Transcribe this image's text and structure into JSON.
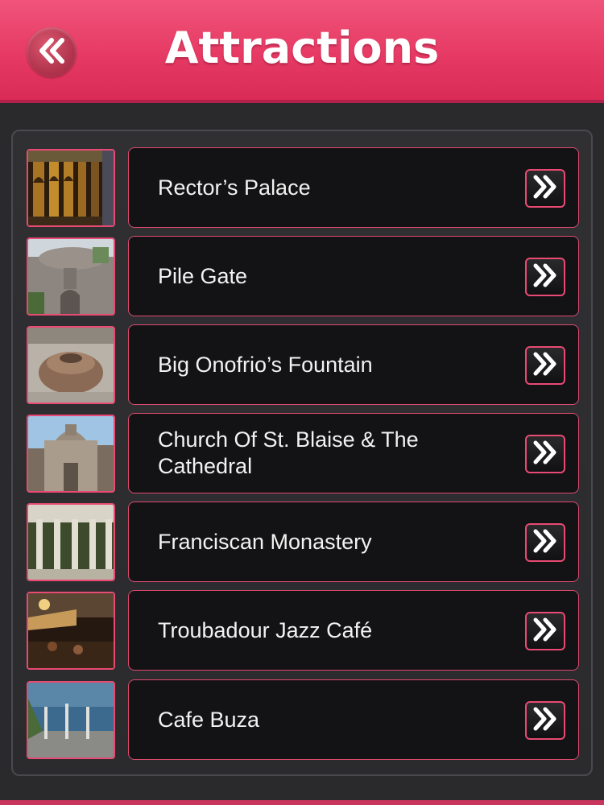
{
  "header": {
    "title": "Attractions",
    "back_icon": "double-chevron-left-icon"
  },
  "colors": {
    "header": "#e63a64",
    "accent_border": "#e84a73",
    "item_background": "#131315",
    "page_background": "#2a2a2c"
  },
  "attractions": [
    {
      "label": "Rector’s Palace",
      "thumbnail": "rectors-palace-photo",
      "action_icon": "double-chevron-right-icon"
    },
    {
      "label": "Pile Gate",
      "thumbnail": "pile-gate-photo",
      "action_icon": "double-chevron-right-icon"
    },
    {
      "label": "Big Onofrio’s Fountain",
      "thumbnail": "onofrio-fountain-photo",
      "action_icon": "double-chevron-right-icon"
    },
    {
      "label": "Church Of St. Blaise & The Cathedral",
      "thumbnail": "st-blaise-church-photo",
      "action_icon": "double-chevron-right-icon"
    },
    {
      "label": "Franciscan Monastery",
      "thumbnail": "franciscan-monastery-photo",
      "action_icon": "double-chevron-right-icon"
    },
    {
      "label": "Troubadour Jazz Café",
      "thumbnail": "troubadour-cafe-photo",
      "action_icon": "double-chevron-right-icon"
    },
    {
      "label": "Cafe Buza",
      "thumbnail": "cafe-buza-photo",
      "action_icon": "double-chevron-right-icon"
    }
  ]
}
